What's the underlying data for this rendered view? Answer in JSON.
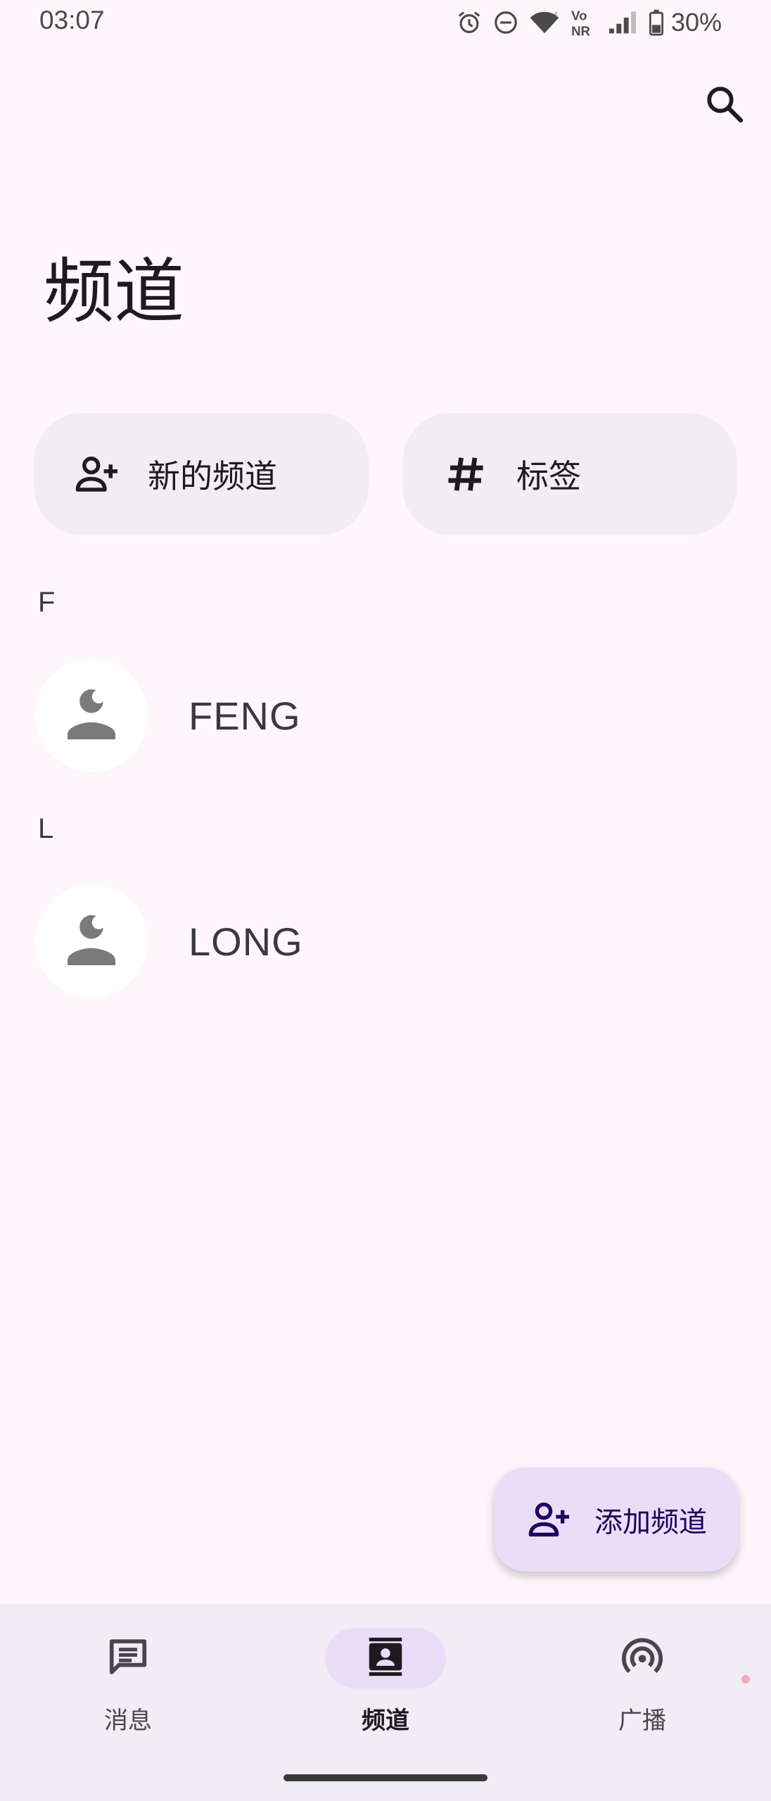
{
  "status_bar": {
    "time": "03:07",
    "battery": "30%",
    "icons": [
      "alarm-icon",
      "dnd-icon",
      "wifi-icon",
      "vonr-icon",
      "signal-icon",
      "battery-icon"
    ]
  },
  "header": {
    "title": "频道",
    "search_icon": "search-icon"
  },
  "actions": {
    "new_channel": {
      "label": "新的频道",
      "icon": "person-add-icon"
    },
    "tags": {
      "label": "标签",
      "icon": "hash-icon"
    }
  },
  "contacts": [
    {
      "letter": "F",
      "name": "FENG"
    },
    {
      "letter": "L",
      "name": "LONG"
    }
  ],
  "fab": {
    "label": "添加频道",
    "icon": "person-add-icon"
  },
  "bottom_nav": {
    "items": [
      {
        "label": "消息",
        "icon": "message-icon",
        "active": false
      },
      {
        "label": "频道",
        "icon": "contacts-icon",
        "active": true
      },
      {
        "label": "广播",
        "icon": "broadcast-icon",
        "active": false
      }
    ]
  },
  "colors": {
    "background": "#fdf7fc",
    "button_bg": "#f1edf2",
    "fab_bg": "#e9def8",
    "nav_bg": "#f2ecf4",
    "avatar_icon": "#7a7a7a"
  }
}
